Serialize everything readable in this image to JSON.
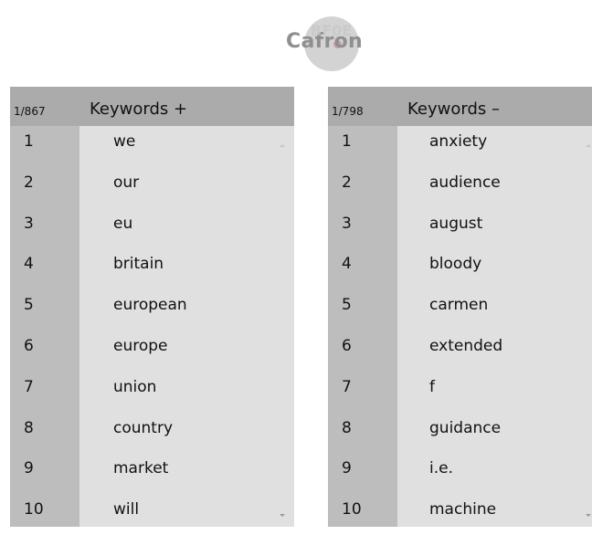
{
  "app": {
    "logo_text": "Cafron",
    "logo_overlay": "BF0E"
  },
  "left_panel": {
    "count": "1/867",
    "title": "Keywords +",
    "rows": [
      {
        "n": "1",
        "w": "we"
      },
      {
        "n": "2",
        "w": "our"
      },
      {
        "n": "3",
        "w": "eu"
      },
      {
        "n": "4",
        "w": "britain"
      },
      {
        "n": "5",
        "w": "european"
      },
      {
        "n": "6",
        "w": "europe"
      },
      {
        "n": "7",
        "w": "union"
      },
      {
        "n": "8",
        "w": "country"
      },
      {
        "n": "9",
        "w": "market"
      },
      {
        "n": "10",
        "w": "will"
      }
    ]
  },
  "right_panel": {
    "count": "1/798",
    "title": "Keywords –",
    "rows": [
      {
        "n": "1",
        "w": "anxiety"
      },
      {
        "n": "2",
        "w": "audience"
      },
      {
        "n": "3",
        "w": "august"
      },
      {
        "n": "4",
        "w": "bloody"
      },
      {
        "n": "5",
        "w": "carmen"
      },
      {
        "n": "6",
        "w": "extended"
      },
      {
        "n": "7",
        "w": "f"
      },
      {
        "n": "8",
        "w": "guidance"
      },
      {
        "n": "9",
        "w": "i.e."
      },
      {
        "n": "10",
        "w": "machine"
      }
    ]
  }
}
